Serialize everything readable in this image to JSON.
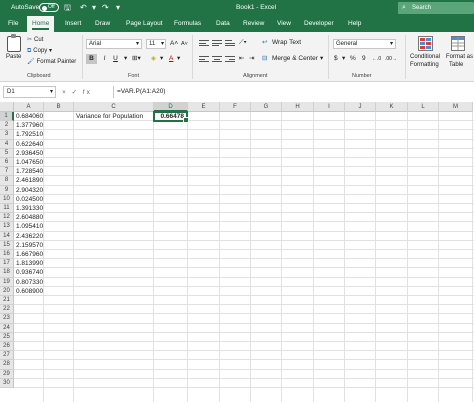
{
  "titlebar": {
    "autosave_label": "AutoSave",
    "autosave_state": "Off",
    "title": "Book1 - Excel",
    "search_placeholder": "Search",
    "bar_color": "#217346"
  },
  "tabs": [
    "File",
    "Home",
    "Insert",
    "Draw",
    "Page Layout",
    "Formulas",
    "Data",
    "Review",
    "View",
    "Developer",
    "Help"
  ],
  "active_tab": "Home",
  "ribbon": {
    "clipboard": {
      "paste": "Paste",
      "cut": "Cut",
      "copy": "Copy",
      "format_painter": "Format Painter",
      "group": "Clipboard"
    },
    "font": {
      "name": "Arial",
      "size": "11",
      "grow": "A˄",
      "shrink": "A˅",
      "bold": "B",
      "italic": "I",
      "underline": "U",
      "group": "Font"
    },
    "alignment": {
      "wrap_text": "Wrap Text",
      "merge_center": "Merge & Center",
      "group": "Alignment"
    },
    "number": {
      "format": "General",
      "currency": "$",
      "percent": "%",
      "comma": "9",
      "group": "Number"
    },
    "styles": {
      "conditional_formatting_1": "Conditional",
      "conditional_formatting_2": "Formatting",
      "format_table_1": "Format as",
      "format_table_2": "Table"
    }
  },
  "formula_bar": {
    "name_box": "D1",
    "fx": "× ✓ fx",
    "formula": "=VAR.P(A1:A20)"
  },
  "columns": [
    "A",
    "B",
    "C",
    "D",
    "E",
    "F",
    "G",
    "H",
    "I",
    "J",
    "K",
    "L",
    "M"
  ],
  "rows": [
    "1",
    "2",
    "3",
    "4",
    "5",
    "6",
    "7",
    "8",
    "9",
    "10",
    "11",
    "12",
    "13",
    "14",
    "15",
    "16",
    "17",
    "18",
    "19",
    "20",
    "21",
    "22",
    "23",
    "24",
    "25",
    "26",
    "27",
    "28",
    "29",
    "30"
  ],
  "column_a_values": [
    "0.684060",
    "1.377960",
    "1.792510",
    "0.622640",
    "2.936450",
    "1.047650",
    "1.728540",
    "2.461890",
    "2.904320",
    "0.024500",
    "1.391330",
    "2.604880",
    "1.095410",
    "2.436220",
    "2.159570",
    "1.667960",
    "1.813990",
    "0.936740",
    "0.807330",
    "0.608900"
  ],
  "c1_label": "Variance for Population",
  "d1_value": "0.66478",
  "accent_color": "#217346"
}
